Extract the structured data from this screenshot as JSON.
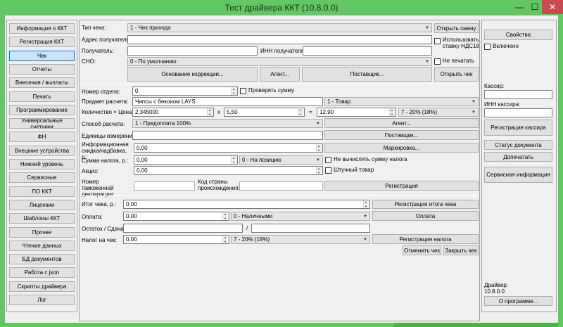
{
  "window": {
    "title": "Тест драйвера ККТ (10.8.0.0)",
    "minimize": "—",
    "maximize": "☐",
    "close": "✕"
  },
  "sidebar": {
    "items": [
      {
        "label": "Информация о ККТ"
      },
      {
        "label": "Регистрация ККТ"
      },
      {
        "label": "Чек",
        "active": true
      },
      {
        "label": "Отчеты"
      },
      {
        "label": "Внесения / выплаты"
      },
      {
        "label": "Печать"
      },
      {
        "label": "Программирование"
      },
      {
        "label": "Универсальные счетчики"
      },
      {
        "label": "ФН"
      },
      {
        "label": "Внешние устройства"
      },
      {
        "label": "Нижний уровень"
      },
      {
        "label": "Сервисные"
      },
      {
        "label": "ПО ККТ"
      },
      {
        "label": "Лицензии"
      },
      {
        "label": "Шаблоны ККТ"
      },
      {
        "label": "Прочее"
      },
      {
        "label": "Чтение данных"
      },
      {
        "label": "БД документов"
      },
      {
        "label": "Работа с json"
      },
      {
        "label": "Скрипты драйвера"
      },
      {
        "label": "Лог"
      }
    ]
  },
  "receipt": {
    "type_label": "Тип чека:",
    "type_value": "1 - Чек прихода",
    "open_shift": "Открыть смену",
    "address_label": "Адрес получателя:",
    "address_value": "",
    "use_vat18": "Использовать ставку НДС18",
    "recipient_label": "Получатель:",
    "recipient_value": "",
    "recipient_inn_label": "ИНН получателя:",
    "recipient_inn_value": "",
    "sno_label": "СНО:",
    "sno_value": "0 - По умолчанию",
    "dont_print": "Не печатать",
    "basis_correction": "Основание коррекции...",
    "agent": "Агент...",
    "supplier": "Поставщик...",
    "open_receipt": "Открыть чек"
  },
  "position": {
    "department_label": "Номер отдела:",
    "department_value": "0",
    "check_sum": "Проверять сумму",
    "item_label": "Предмет расчета:",
    "item_value": "Чипсы с беконом LAYS",
    "item_type_value": "1 - Товар",
    "qty_price_label": "Количество × Цена:",
    "qty_value": "2,345000",
    "times": "x",
    "price_value": "5,50",
    "equals": "=",
    "total_value": "12,90",
    "vat_value": "7 - 20% (18%)",
    "payment_method_label": "Способ расчета:",
    "payment_method_value": "1 - Предоплата 100%",
    "agent": "Агент...",
    "units_label": "Единицы измерения:",
    "units_value": "",
    "supplier": "Поставщик...",
    "info_discount_label": "Информационная скидка/надбавка, р.:",
    "info_discount_value": "0,00",
    "marking": "Маркировка...",
    "tax_sum_label": "Сумма налога, р.:",
    "tax_sum_value": "0,00",
    "tax_mode_value": "0 - На позицию",
    "dont_calc_tax": "Не вычислять сумму налога",
    "excise_label": "Акциз:",
    "excise_value": "0,00",
    "piece_goods": "Штучный товар",
    "customs_label": "Номер таможенной декларации:",
    "customs_value": "",
    "country_label": "Код страны происхождения:",
    "country_value": "",
    "register": "Регистрация"
  },
  "totals": {
    "total_label": "Итог чека, р.:",
    "total_value": "0,00",
    "register_total": "Регистрация итога чека",
    "payment_label": "Оплата:",
    "payment_value": "0,00",
    "payment_type_value": "0 - Наличными",
    "pay": "Оплата",
    "change_label": "Остаток / Сдача:",
    "change_value": "",
    "slash": "/",
    "change_value2": "",
    "tax_label": "Налог на чек:",
    "tax_value": "0,00",
    "tax_rate_value": "7 - 20% (18%)",
    "register_tax": "Регистрация налога",
    "cancel_receipt": "Отменить чек",
    "close_receipt": "Закрыть чек"
  },
  "right": {
    "properties": "Свойства",
    "enabled": "Включено",
    "cashier_label": "Кассир:",
    "cashier_value": "",
    "cashier_inn_label": "ИНН кассира:",
    "cashier_inn_value": "",
    "register_cashier": "Регистрация кассира",
    "doc_status": "Статус документа",
    "reprint": "Допечатать",
    "service_info": "Сервисная информация",
    "driver_label": "Драйвер:",
    "driver_version": "10.8.0.0",
    "about": "О программе..."
  }
}
